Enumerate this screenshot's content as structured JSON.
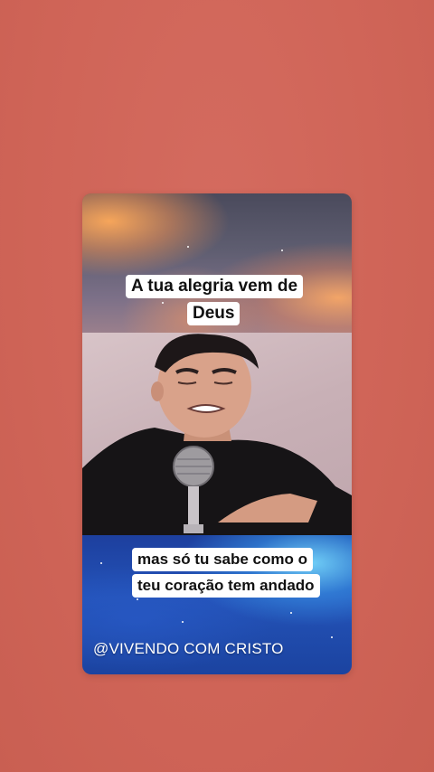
{
  "colors": {
    "page_background": "#d2675b",
    "caption_background": "#ffffff",
    "caption_text": "#111111",
    "watermark_text": "#ffffff"
  },
  "video_card": {
    "caption_top": {
      "line1": "A tua alegria vem de",
      "line2": "Deus"
    },
    "caption_bottom": {
      "line1": "mas só tu sabe como o",
      "line2": "teu coração tem andado"
    },
    "watermark": "@VIVENDO COM CRISTO"
  }
}
